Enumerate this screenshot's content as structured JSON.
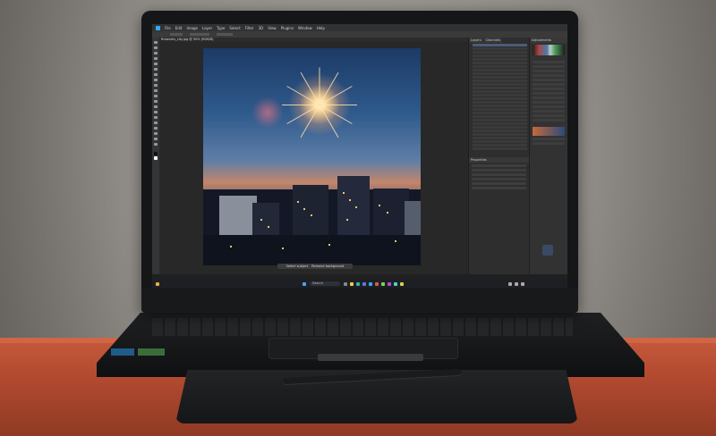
{
  "photoshop": {
    "menus": [
      "File",
      "Edit",
      "Image",
      "Layer",
      "Type",
      "Select",
      "Filter",
      "3D",
      "View",
      "Plugins",
      "Window",
      "Help"
    ],
    "document_tab": "fireworks_city.jpg @ 50% (RGB/8)",
    "context_bar": {
      "select_subject": "Select subject",
      "remove_background": "Remove background"
    },
    "panels": {
      "layers_tab": "Layers",
      "channels_tab": "Channels",
      "adjustments_tab": "Adjustments",
      "properties_tab": "Properties"
    }
  },
  "taskbar": {
    "search_placeholder": "Search"
  },
  "colors": {
    "sky_top": "#1c3a66",
    "firework": "#ffe3a6",
    "desk": "#b24a30",
    "ui_panel": "#2e2e2e"
  }
}
